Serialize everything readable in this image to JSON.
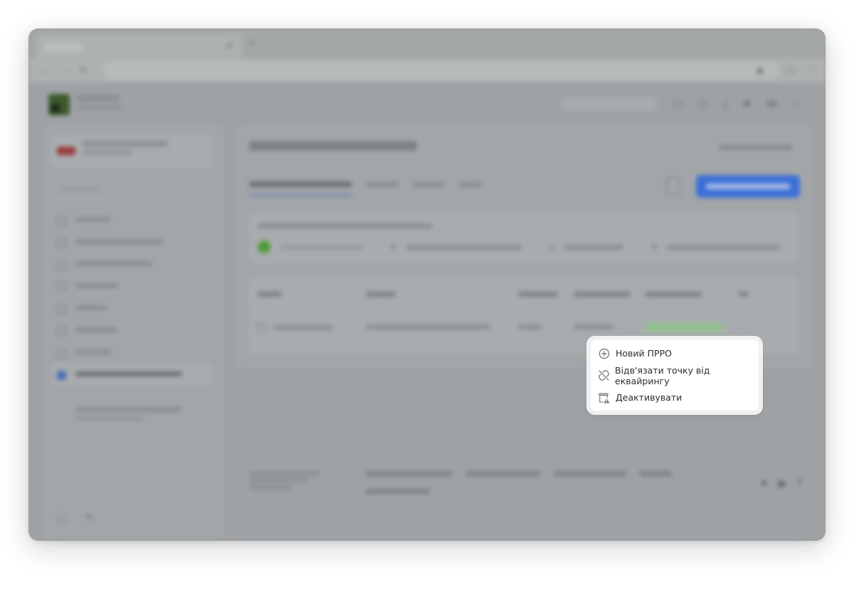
{
  "background_app": {
    "chrome": {
      "tab_close_glyph": "✕",
      "new_tab_glyph": "+"
    },
    "header": {
      "logo_icon": "brand-logo-icon"
    },
    "sidebar": {
      "items_icon": "menu-item-icon"
    },
    "main": {
      "active_tab_color": "#4a6fb2",
      "primary_button_color": "#3b6fd8",
      "status_color": "#8fc28b"
    }
  },
  "context_menu": {
    "items": [
      {
        "label": "Новий ПРРО",
        "icon": "plus-circle-icon"
      },
      {
        "label": "Відв'язати точку від еквайрингу",
        "icon": "unlink-icon"
      },
      {
        "label": "Деактивувати",
        "icon": "store-warning-icon"
      }
    ]
  }
}
